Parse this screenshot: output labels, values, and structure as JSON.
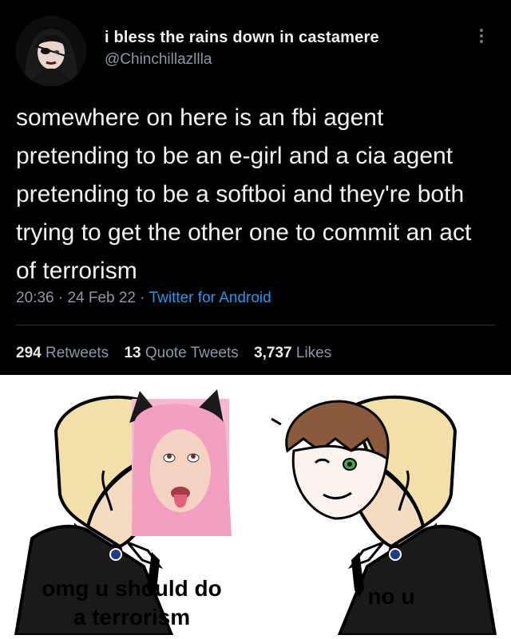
{
  "tweet": {
    "display_name": "i bless the rains down in castamere",
    "handle": "@Chinchillazllla",
    "text": "somewhere on here is an fbi agent pretending to be an e-girl and a cia agent pretending to be a softboi and they're both trying to get the other one to commit an act of terrorism",
    "time": "20:36",
    "date": "24 Feb 22",
    "source": "Twitter for Android",
    "retweets_count": "294",
    "retweets_label": "Retweets",
    "quotes_count": "13",
    "quotes_label": "Quote Tweets",
    "likes_count": "3,737",
    "likes_label": "Likes"
  },
  "meme": {
    "caption_left_line1": "omg u should do",
    "caption_left_line2": "a terrorism",
    "caption_right": "no u"
  }
}
